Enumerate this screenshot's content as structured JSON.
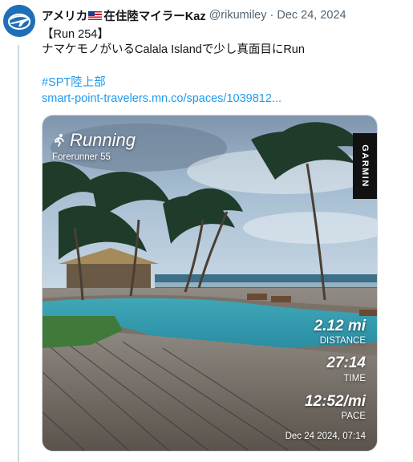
{
  "tweet": {
    "author_name": "アメリカ",
    "author_name_suffix": "在住陸マイラーKaz",
    "handle": "@rikumiley",
    "separator": "·",
    "date": "Dec 24, 2024",
    "lines": [
      "【Run 254】",
      "ナマケモノがいるCalala Islandで少し真面目にRun"
    ],
    "hashtag": "#SPT陸上部",
    "link": "smart-point-travelers.mn.co/spaces/1039812..."
  },
  "media": {
    "activity": "Running",
    "device": "Forerunner 55",
    "brand": "GARMIN",
    "distance_value": "2.12 mi",
    "distance_label": "DISTANCE",
    "time_value": "27:14",
    "time_label": "TIME",
    "pace_value": "12:52/mi",
    "pace_label": "PACE",
    "timestamp": "Dec 24 2024, 07:14"
  },
  "colors": {
    "link": "#1d9bf0",
    "muted": "#536471",
    "avatar": "#1f6fb8"
  },
  "icons": {
    "avatar": "globe-plane-logo",
    "flag": "us-flag-icon",
    "runner": "runner-icon"
  }
}
